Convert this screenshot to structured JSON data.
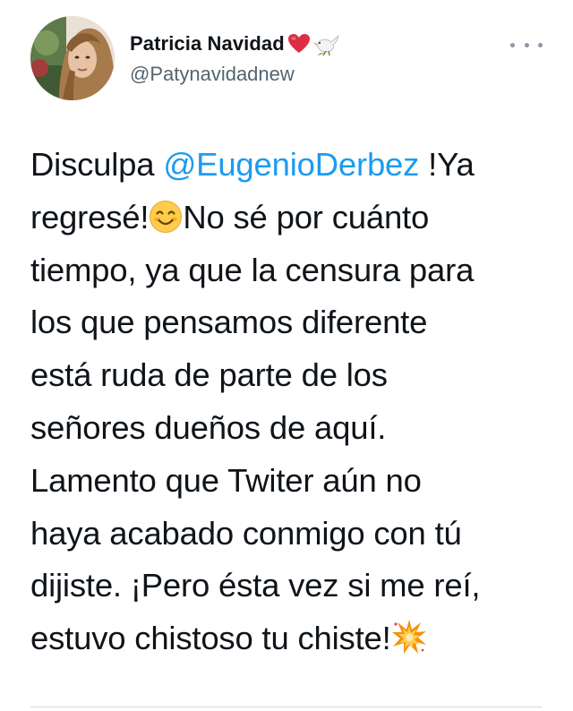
{
  "author": {
    "display_name": "Patricia Navidad",
    "handle": "@Patynavidadnew",
    "name_emojis": [
      "red-heart-icon",
      "dove-icon"
    ]
  },
  "more_menu": {
    "icon": "more-horizontal-icon"
  },
  "tweet": {
    "lines": [
      {
        "segments": [
          {
            "type": "text",
            "value": "Disculpa "
          },
          {
            "type": "mention",
            "value": "@EugenioDerbez"
          },
          {
            "type": "text",
            "value": " !Ya"
          }
        ]
      },
      {
        "segments": [
          {
            "type": "text",
            "value": "regresé!"
          },
          {
            "type": "emoji",
            "name": "smiling-face-icon"
          },
          {
            "type": "text",
            "value": "No sé por cuánto"
          }
        ]
      },
      {
        "segments": [
          {
            "type": "text",
            "value": "tiempo, ya que la censura para"
          }
        ]
      },
      {
        "segments": [
          {
            "type": "text",
            "value": "los que pensamos diferente"
          }
        ]
      },
      {
        "segments": [
          {
            "type": "text",
            "value": "está ruda de parte de los"
          }
        ]
      },
      {
        "segments": [
          {
            "type": "text",
            "value": "señores dueños de aquí."
          }
        ]
      },
      {
        "segments": [
          {
            "type": "text",
            "value": "Lamento que Twiter aún no"
          }
        ]
      },
      {
        "segments": [
          {
            "type": "text",
            "value": "haya acabado conmigo con tú"
          }
        ]
      },
      {
        "segments": [
          {
            "type": "text",
            "value": "dijiste. ¡Pero ésta vez si me reí,"
          }
        ]
      },
      {
        "segments": [
          {
            "type": "text",
            "value": "estuvo chistoso tu chiste!"
          },
          {
            "type": "emoji",
            "name": "collision-icon"
          }
        ]
      }
    ]
  },
  "colors": {
    "text": "#0f1419",
    "secondary": "#536471",
    "link": "#1d9bf0",
    "divider": "#cfd9de"
  }
}
